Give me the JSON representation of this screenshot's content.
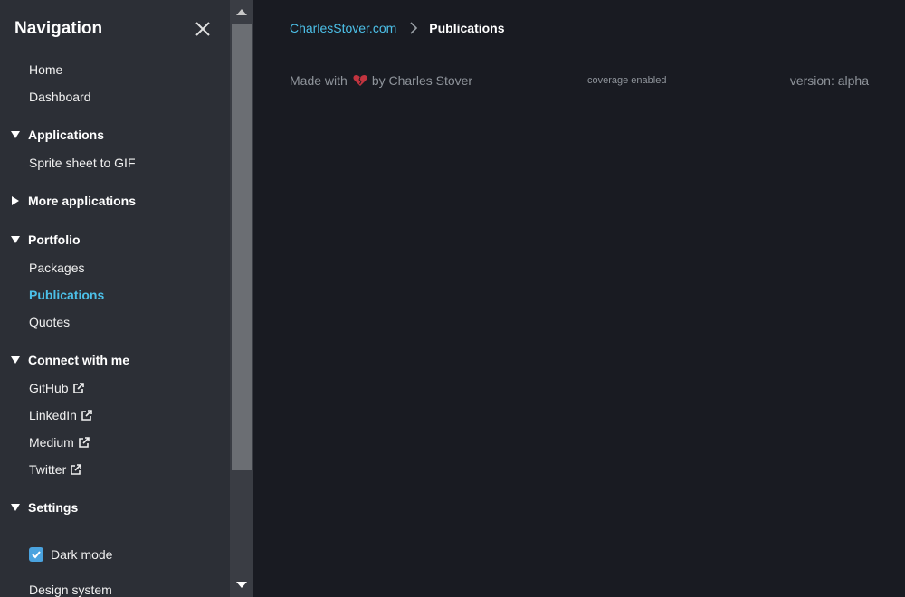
{
  "sidebar": {
    "title": "Navigation",
    "items": {
      "home": "Home",
      "dashboard": "Dashboard",
      "sprite_sheet": "Sprite sheet to GIF",
      "packages": "Packages",
      "publications": "Publications",
      "quotes": "Quotes",
      "github": "GitHub",
      "linkedin": "LinkedIn",
      "medium": "Medium",
      "twitter": "Twitter",
      "dark_mode": "Dark mode",
      "design_system": "Design system"
    },
    "sections": {
      "applications": "Applications",
      "more_applications": "More applications",
      "portfolio": "Portfolio",
      "connect": "Connect with me",
      "settings": "Settings"
    },
    "dark_mode_checked": true
  },
  "breadcrumb": {
    "root": "CharlesStover.com",
    "current": "Publications"
  },
  "footer": {
    "made_with": "Made with",
    "by": "by Charles Stover",
    "coverage": "coverage enabled",
    "version": "version: alpha"
  },
  "colors": {
    "accent": "#4cc0e8",
    "sidebar_bg": "#2c2f36",
    "main_bg": "#191b22",
    "heart": "#c2343f"
  }
}
